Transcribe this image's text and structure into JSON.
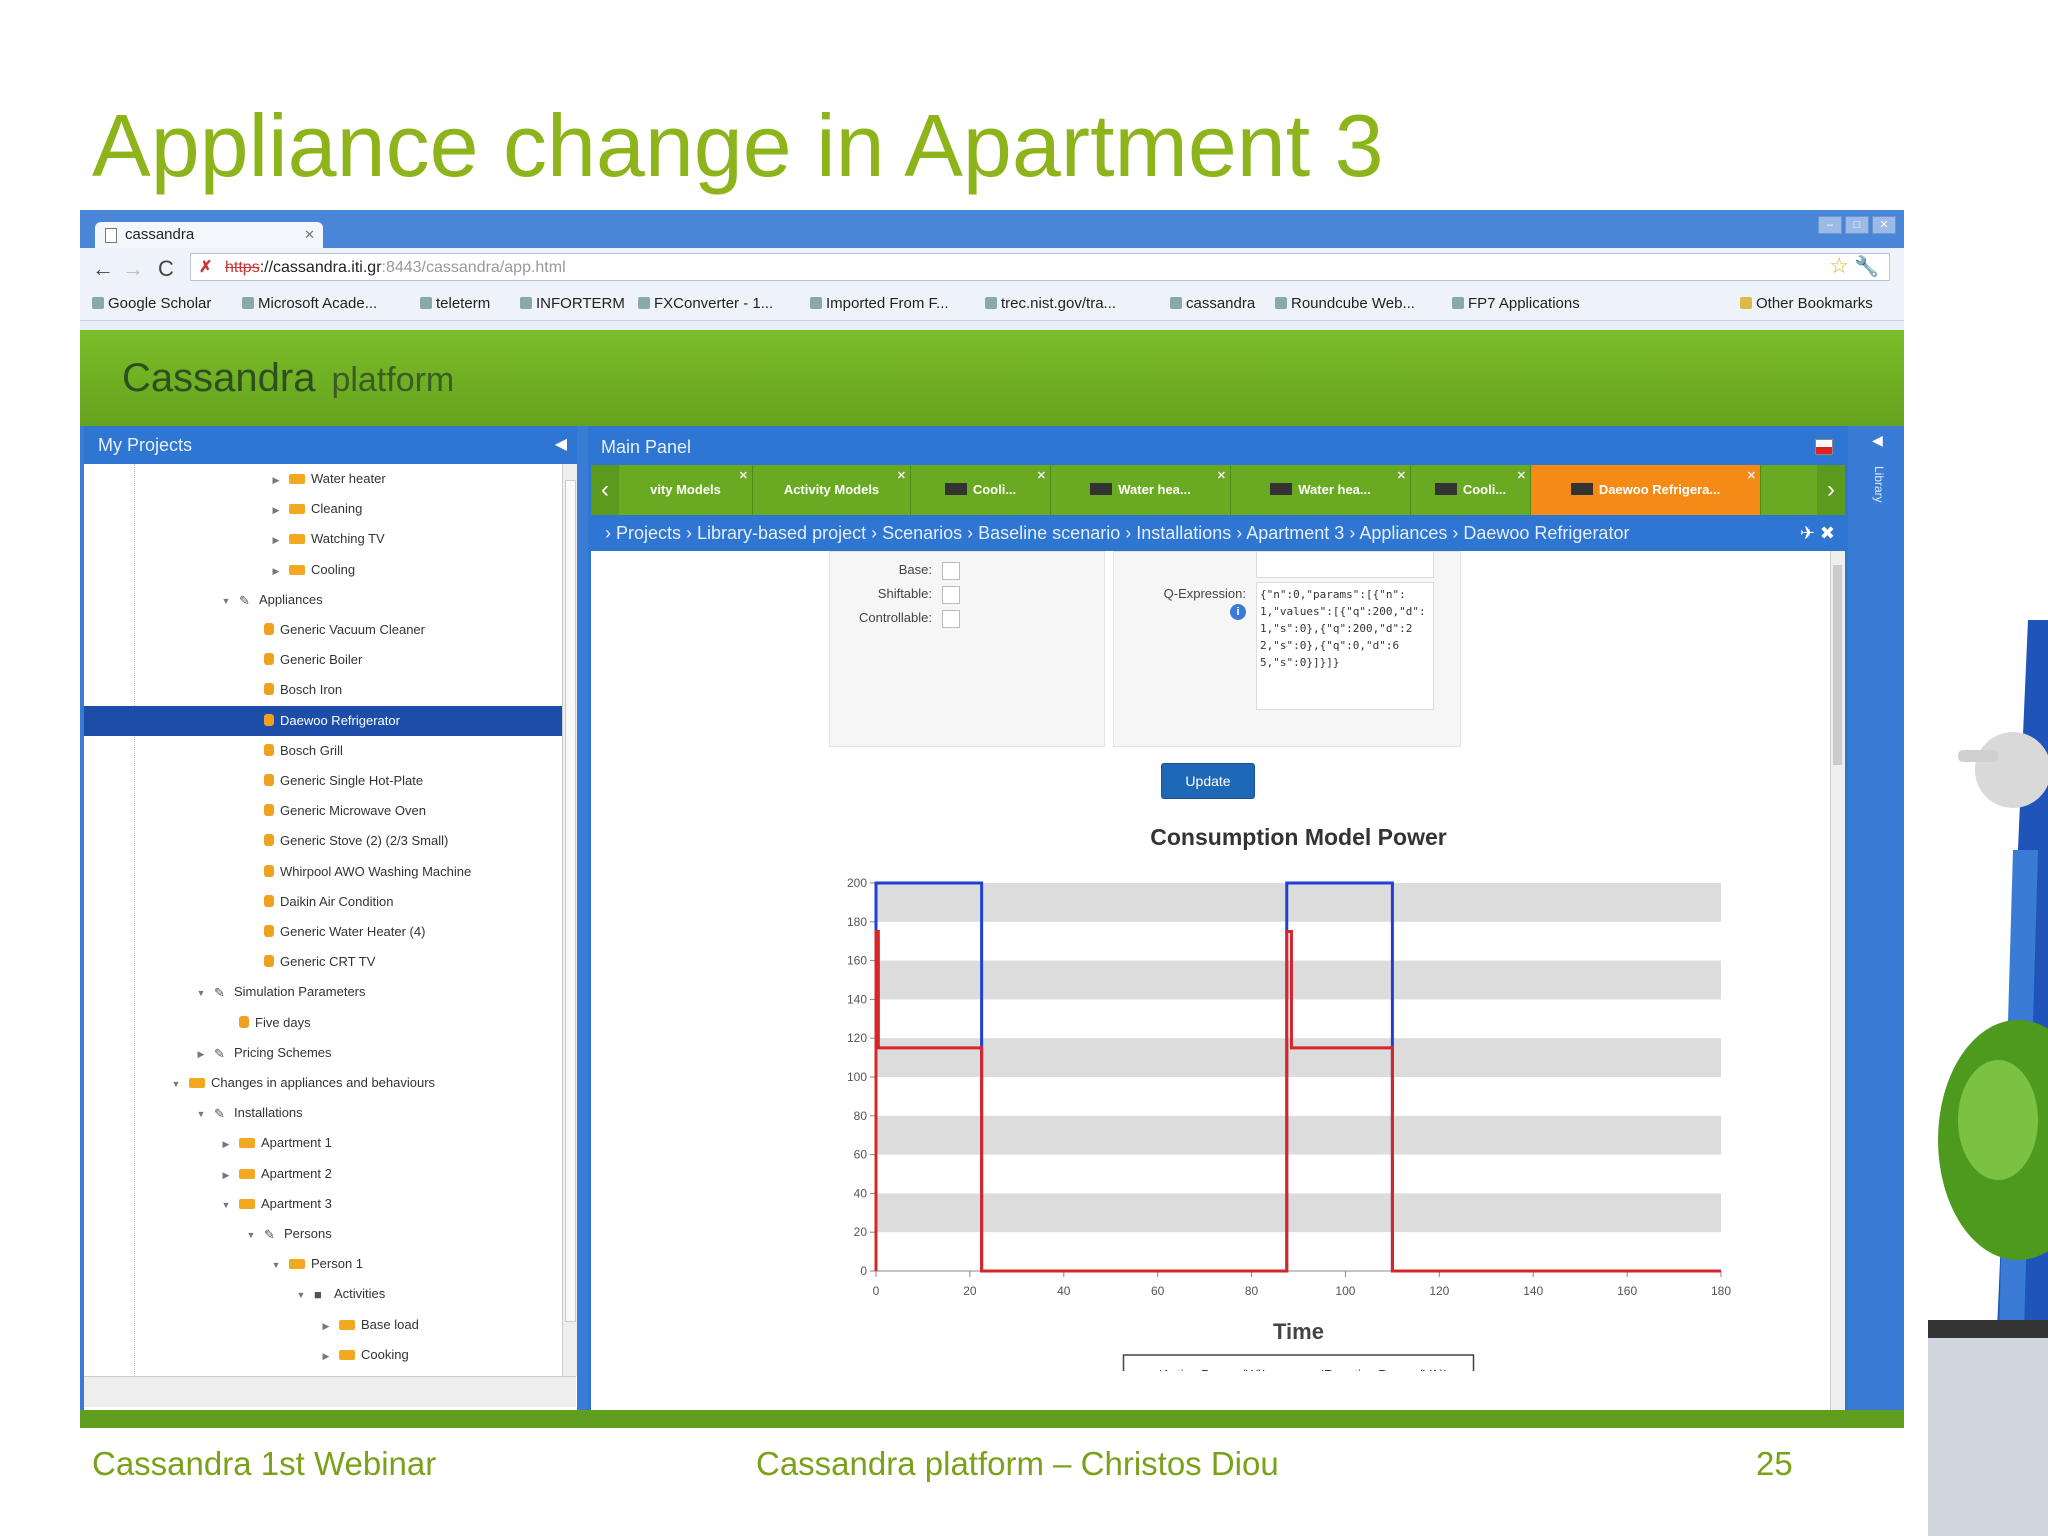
{
  "slide": {
    "title": "Appliance change in Apartment 3",
    "footer_left": "Cassandra 1st Webinar",
    "footer_center": "Cassandra platform – Christos Diou",
    "page_number": "25"
  },
  "browser": {
    "tab_title": "cassandra",
    "url_scheme": "https",
    "url_host": "://cassandra.iti.gr",
    "url_rest": ":8443/cassandra/app.html",
    "bookmarks": [
      "Google Scholar",
      "Microsoft Acade...",
      "teleterm",
      "INFORTERM",
      "FXConverter - 1...",
      "Imported From F...",
      "trec.nist.gov/tra...",
      "cassandra",
      "Roundcube Web...",
      "FP7 Applications"
    ],
    "other_bookmarks": "Other Bookmarks"
  },
  "app": {
    "logo_main": "Cassandra",
    "logo_sub": "platform"
  },
  "left_panel": {
    "title": "My Projects",
    "tree": [
      {
        "label": "Water heater",
        "indent": 9,
        "icon": "folder",
        "twisty": "▶"
      },
      {
        "label": "Cleaning",
        "indent": 9,
        "icon": "folder",
        "twisty": "▶"
      },
      {
        "label": "Watching TV",
        "indent": 9,
        "icon": "folder",
        "twisty": "▶"
      },
      {
        "label": "Cooling",
        "indent": 9,
        "icon": "folder",
        "twisty": "▶"
      },
      {
        "label": "Appliances",
        "indent": 7,
        "icon": "tool",
        "twisty": "▼"
      },
      {
        "label": "Generic Vacuum Cleaner",
        "indent": 8,
        "icon": "appliance",
        "twisty": ""
      },
      {
        "label": "Generic Boiler",
        "indent": 8,
        "icon": "appliance",
        "twisty": ""
      },
      {
        "label": "Bosch Iron",
        "indent": 8,
        "icon": "appliance",
        "twisty": ""
      },
      {
        "label": "Daewoo Refrigerator",
        "indent": 8,
        "icon": "appliance",
        "twisty": "",
        "selected": true
      },
      {
        "label": "Bosch Grill",
        "indent": 8,
        "icon": "appliance",
        "twisty": ""
      },
      {
        "label": "Generic Single Hot-Plate",
        "indent": 8,
        "icon": "appliance",
        "twisty": ""
      },
      {
        "label": "Generic Microwave Oven",
        "indent": 8,
        "icon": "appliance",
        "twisty": ""
      },
      {
        "label": "Generic Stove (2) (2/3 Small)",
        "indent": 8,
        "icon": "appliance",
        "twisty": ""
      },
      {
        "label": "Whirpool AWO Washing Machine",
        "indent": 8,
        "icon": "appliance",
        "twisty": ""
      },
      {
        "label": "Daikin Air Condition",
        "indent": 8,
        "icon": "appliance",
        "twisty": ""
      },
      {
        "label": "Generic Water Heater (4)",
        "indent": 8,
        "icon": "appliance",
        "twisty": ""
      },
      {
        "label": "Generic CRT TV",
        "indent": 8,
        "icon": "appliance",
        "twisty": ""
      },
      {
        "label": "Simulation Parameters",
        "indent": 6,
        "icon": "chart",
        "twisty": "▼"
      },
      {
        "label": "Five days",
        "indent": 7,
        "icon": "appliance",
        "twisty": ""
      },
      {
        "label": "Pricing Schemes",
        "indent": 6,
        "icon": "tool",
        "twisty": "▶"
      },
      {
        "label": "Changes in appliances and behaviours",
        "indent": 5,
        "icon": "folder",
        "twisty": "▼"
      },
      {
        "label": "Installations",
        "indent": 6,
        "icon": "tool",
        "twisty": "▼"
      },
      {
        "label": "Apartment 1",
        "indent": 7,
        "icon": "folder",
        "twisty": "▶"
      },
      {
        "label": "Apartment 2",
        "indent": 7,
        "icon": "folder",
        "twisty": "▶"
      },
      {
        "label": "Apartment 3",
        "indent": 7,
        "icon": "folder",
        "twisty": "▼"
      },
      {
        "label": "Persons",
        "indent": 8,
        "icon": "people",
        "twisty": "▼"
      },
      {
        "label": "Person 1",
        "indent": 9,
        "icon": "folder",
        "twisty": "▼"
      },
      {
        "label": "Activities",
        "indent": 10,
        "icon": "activity",
        "twisty": "▼"
      },
      {
        "label": "Base load",
        "indent": 11,
        "icon": "folder",
        "twisty": "▶"
      },
      {
        "label": "Cooking",
        "indent": 11,
        "icon": "folder",
        "twisty": "▶"
      }
    ]
  },
  "main_panel": {
    "title": "Main Panel",
    "tabs": [
      {
        "label": "vity Models",
        "icon": false
      },
      {
        "label": "Activity Models",
        "icon": false
      },
      {
        "label": "Cooli...",
        "icon": true
      },
      {
        "label": "Water hea...",
        "icon": true
      },
      {
        "label": "Water hea...",
        "icon": true
      },
      {
        "label": "Cooli...",
        "icon": true
      },
      {
        "label": "Daewoo Refrigera...",
        "icon": true,
        "active": true
      }
    ],
    "breadcrumb": "› Projects › Library-based project › Scenarios › Baseline scenario › Installations › Apartment 3 › Appliances › Daewoo Refrigerator",
    "form": {
      "base_label": "Base:",
      "shiftable_label": "Shiftable:",
      "controllable_label": "Controllable:",
      "qexpr_label": "Q-Expression:",
      "qexpr_value": "{\"n\":0,\"params\":[{\"n\":1,\"values\":[{\"q\":200,\"d\":1,\"s\":0},{\"q\":200,\"d\":22,\"s\":0},{\"q\":0,\"d\":65,\"s\":0}]}]}"
    },
    "update_button": "Update"
  },
  "colors": {
    "slide_green": "#8db51b",
    "app_blue": "#2f76d2",
    "tab_green": "#6aaa22",
    "tab_active": "#f58a16",
    "active_series": "#d62728",
    "reactive_series": "#1f3fd6"
  },
  "chart_data": {
    "type": "line",
    "title": "Consumption Model Power",
    "xlabel": "Time",
    "ylabel": "",
    "xlim": [
      0,
      180
    ],
    "ylim": [
      0,
      200
    ],
    "xticks": [
      0,
      20,
      40,
      60,
      80,
      100,
      120,
      140,
      160,
      180
    ],
    "yticks": [
      0,
      20,
      40,
      60,
      80,
      100,
      120,
      140,
      160,
      180,
      200
    ],
    "grid": "horizontal bands",
    "legend": "bottom-center",
    "series": [
      {
        "name": "'Active Power (W)'",
        "color": "#d62728",
        "x": [
          0,
          0,
          0.5,
          0.5,
          22.5,
          22.5,
          87.5,
          87.5,
          88.5,
          88.5,
          110,
          110,
          180
        ],
        "y": [
          0,
          175,
          175,
          115,
          115,
          0,
          0,
          175,
          175,
          115,
          115,
          0,
          0
        ]
      },
      {
        "name": "'Reactive Power (VA)'",
        "color": "#1f3fd6",
        "x": [
          0,
          0,
          22.5,
          22.5,
          87.5,
          87.5,
          110,
          110,
          180
        ],
        "y": [
          0,
          200,
          200,
          0,
          0,
          200,
          200,
          0,
          0
        ]
      }
    ]
  }
}
